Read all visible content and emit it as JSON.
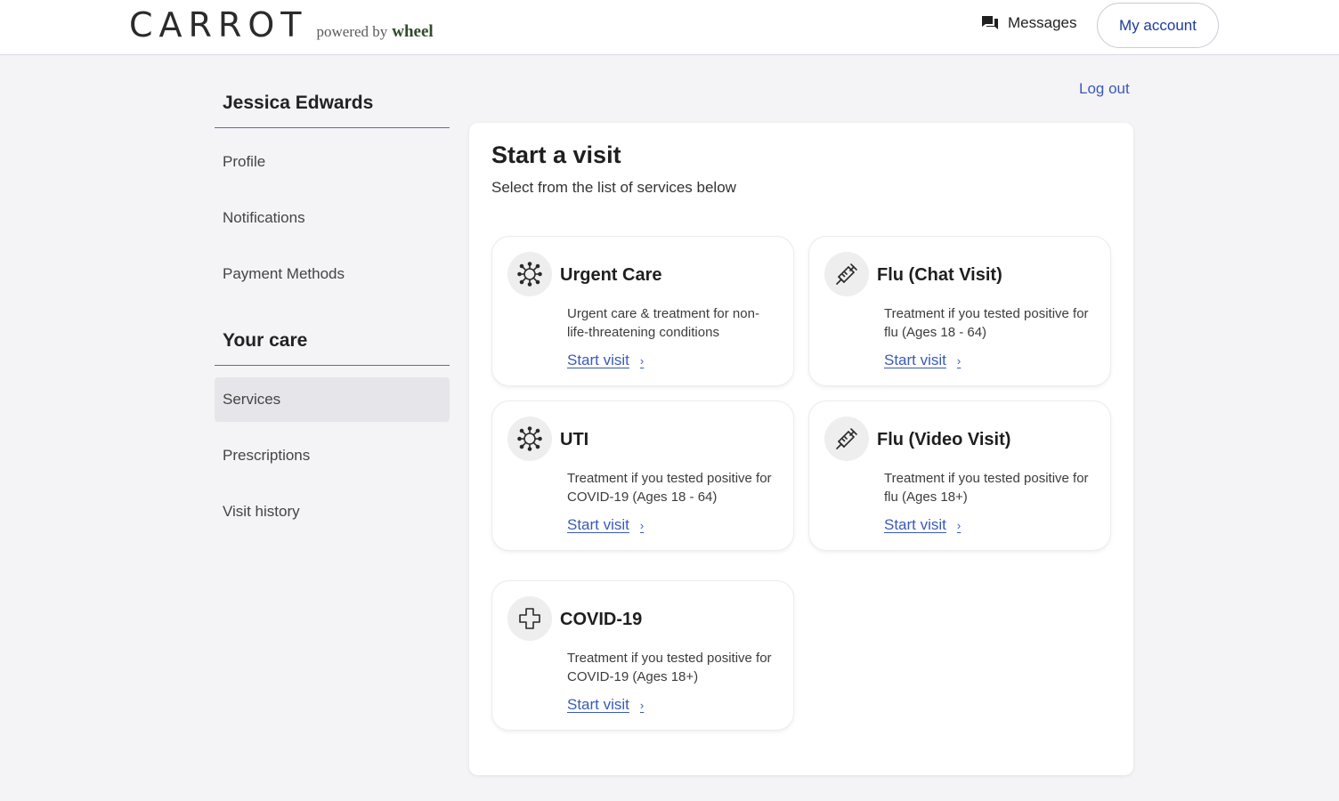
{
  "header": {
    "logo_text": "CARROT",
    "powered_by": "powered by",
    "partner": "wheel",
    "messages_label": "Messages",
    "messages_icon": "chat-bubbles-icon",
    "account_label": "My account"
  },
  "sidebar": {
    "user_name": "Jessica Edwards",
    "account_items": [
      {
        "label": "Profile"
      },
      {
        "label": "Notifications"
      },
      {
        "label": "Payment Methods"
      }
    ],
    "care_heading": "Your care",
    "care_items": [
      {
        "label": "Services",
        "active": true
      },
      {
        "label": "Prescriptions"
      },
      {
        "label": "Visit history"
      }
    ]
  },
  "logout_label": "Log out",
  "main": {
    "title": "Start a visit",
    "subtitle": "Select from the list of services below",
    "services": [
      {
        "title": "Urgent Care",
        "icon": "virus-icon",
        "description": "Urgent care & treatment for non-life-threatening conditions",
        "link": "Start visit"
      },
      {
        "title": "Flu (Chat Visit)",
        "icon": "syringe-icon",
        "description": "Treatment if you tested positive for flu (Ages 18 - 64)",
        "link": "Start visit"
      },
      {
        "title": "UTI",
        "icon": "virus-icon",
        "description": "Treatment if you tested positive for COVID-19 (Ages 18 - 64)",
        "link": "Start visit"
      },
      {
        "title": "Flu (Video Visit)",
        "icon": "syringe-icon",
        "description": "Treatment if you tested positive for flu (Ages 18+)",
        "link": "Start visit"
      },
      {
        "title": "COVID-19",
        "icon": "medical-cross-icon",
        "description": "Treatment if you tested positive for COVID-19 (Ages  18+)",
        "link": "Start visit"
      }
    ]
  },
  "colors": {
    "link": "#3a5ab6",
    "account_text": "#1d3b9c",
    "background": "#f4f4f6"
  }
}
